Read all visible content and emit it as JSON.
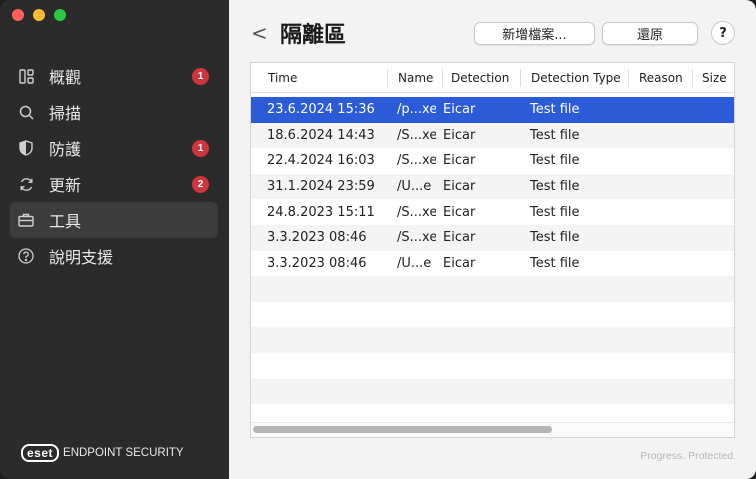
{
  "sidebar": {
    "items": [
      {
        "label": "概觀",
        "icon": "overview-icon",
        "badge": "1"
      },
      {
        "label": "掃描",
        "icon": "search-icon",
        "badge": ""
      },
      {
        "label": "防護",
        "icon": "shield-icon",
        "badge": "1"
      },
      {
        "label": "更新",
        "icon": "refresh-icon",
        "badge": "2"
      },
      {
        "label": "工具",
        "icon": "briefcase-icon",
        "badge": "",
        "active": true
      },
      {
        "label": "說明支援",
        "icon": "help-circle-icon",
        "badge": ""
      }
    ],
    "brand_logo": "eset",
    "brand_text": "ENDPOINT SECURITY"
  },
  "header": {
    "back": "<",
    "title": "隔離區",
    "add_file_label": "新增檔案...",
    "restore_label": "還原",
    "help_label": "?"
  },
  "table": {
    "columns": [
      "Time",
      "Name",
      "Detection",
      "Detection Type",
      "Reason",
      "Size"
    ],
    "rows": [
      {
        "time": "23.6.2024 15:36",
        "name": "/p...xe",
        "detection": "Eicar",
        "type": "Test file",
        "selected": true
      },
      {
        "time": "18.6.2024 14:43",
        "name": "/S...xe",
        "detection": "Eicar",
        "type": "Test file"
      },
      {
        "time": "22.4.2024 16:03",
        "name": "/S...xe",
        "detection": "Eicar",
        "type": "Test file"
      },
      {
        "time": "31.1.2024 23:59",
        "name": "/U...e",
        "detection": "Eicar",
        "type": "Test file"
      },
      {
        "time": "24.8.2023 15:11",
        "name": "/S...xe",
        "detection": "Eicar",
        "type": "Test file"
      },
      {
        "time": "3.3.2023 08:46",
        "name": "/S...xe",
        "detection": "Eicar",
        "type": "Test file"
      },
      {
        "time": "3.3.2023 08:46",
        "name": "/U...e",
        "detection": "Eicar",
        "type": "Test file"
      }
    ]
  },
  "footer": {
    "tagline": "Progress. Protected."
  },
  "colors": {
    "accent": "#2c5bd8",
    "badge": "#d0343c",
    "sidebar": "#2b2b2b"
  }
}
